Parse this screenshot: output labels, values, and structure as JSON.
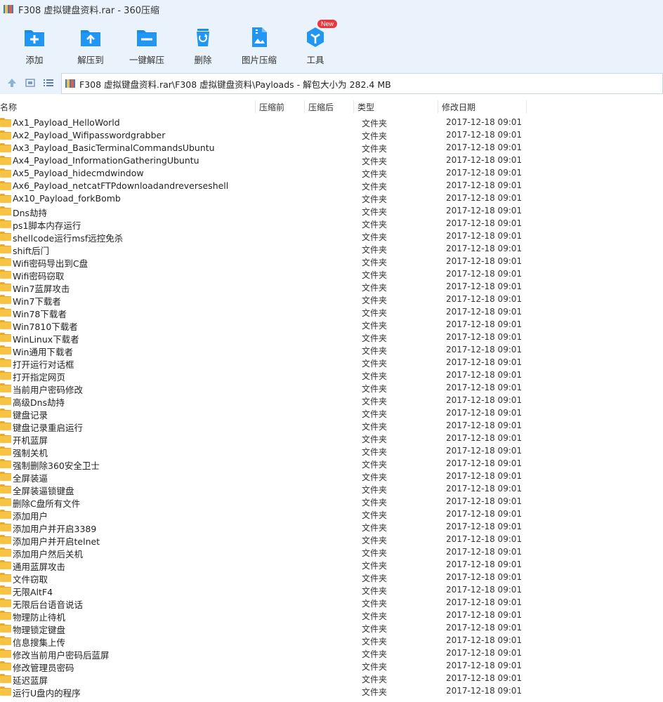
{
  "window": {
    "title": "F308  虚拟键盘资料.rar - 360压缩"
  },
  "toolbar": {
    "items": [
      {
        "label": "添加",
        "icon": "add-icon"
      },
      {
        "label": "解压到",
        "icon": "extract-to-icon"
      },
      {
        "label": "一键解压",
        "icon": "one-click-extract-icon"
      },
      {
        "label": "删除",
        "icon": "delete-icon"
      },
      {
        "label": "图片压缩",
        "icon": "image-compress-icon"
      },
      {
        "label": "工具",
        "icon": "tools-icon",
        "badge": "New"
      }
    ]
  },
  "addressbar": {
    "path": "F308  虚拟键盘资料.rar\\F308  虚拟键盘资料\\Payloads - 解包大小为 282.4 MB"
  },
  "columns": {
    "name": "名称",
    "compressed_before": "压缩前",
    "compressed_after": "压缩后",
    "type": "类型",
    "modified": "修改日期"
  },
  "files": [
    {
      "name": "Ax1_Payload_HelloWorld",
      "type": "文件夹",
      "date": "2017-12-18 09:01"
    },
    {
      "name": "Ax2_Payload_Wifipasswordgrabber",
      "type": "文件夹",
      "date": "2017-12-18 09:01"
    },
    {
      "name": "Ax3_Payload_BasicTerminalCommandsUbuntu",
      "type": "文件夹",
      "date": "2017-12-18 09:01"
    },
    {
      "name": "Ax4_Payload_InformationGatheringUbuntu",
      "type": "文件夹",
      "date": "2017-12-18 09:01"
    },
    {
      "name": "Ax5_Payload_hidecmdwindow",
      "type": "文件夹",
      "date": "2017-12-18 09:01"
    },
    {
      "name": "Ax6_Payload_netcatFTPdownloadandreverseshell",
      "type": "文件夹",
      "date": "2017-12-18 09:01"
    },
    {
      "name": "Ax10_Payload_forkBomb",
      "type": "文件夹",
      "date": "2017-12-18 09:01"
    },
    {
      "name": "Dns劫持",
      "type": "文件夹",
      "date": "2017-12-18 09:01"
    },
    {
      "name": "ps1脚本内存运行",
      "type": "文件夹",
      "date": "2017-12-18 09:01"
    },
    {
      "name": "shellcode运行msf远控免杀",
      "type": "文件夹",
      "date": "2017-12-18 09:01"
    },
    {
      "name": "shift后门",
      "type": "文件夹",
      "date": "2017-12-18 09:01"
    },
    {
      "name": "Wifi密码导出到C盘",
      "type": "文件夹",
      "date": "2017-12-18 09:01"
    },
    {
      "name": "Wifi密码窃取",
      "type": "文件夹",
      "date": "2017-12-18 09:01"
    },
    {
      "name": "Win7蓝屏攻击",
      "type": "文件夹",
      "date": "2017-12-18 09:01"
    },
    {
      "name": "Win7下载者",
      "type": "文件夹",
      "date": "2017-12-18 09:01"
    },
    {
      "name": "Win78下载者",
      "type": "文件夹",
      "date": "2017-12-18 09:01"
    },
    {
      "name": "Win7810下载者",
      "type": "文件夹",
      "date": "2017-12-18 09:01"
    },
    {
      "name": "WinLinux下载者",
      "type": "文件夹",
      "date": "2017-12-18 09:01"
    },
    {
      "name": "Win通用下载者",
      "type": "文件夹",
      "date": "2017-12-18 09:01"
    },
    {
      "name": "打开运行对话框",
      "type": "文件夹",
      "date": "2017-12-18 09:01"
    },
    {
      "name": "打开指定网页",
      "type": "文件夹",
      "date": "2017-12-18 09:01"
    },
    {
      "name": "当前用户密码修改",
      "type": "文件夹",
      "date": "2017-12-18 09:01"
    },
    {
      "name": "高级Dns劫持",
      "type": "文件夹",
      "date": "2017-12-18 09:01"
    },
    {
      "name": "键盘记录",
      "type": "文件夹",
      "date": "2017-12-18 09:01"
    },
    {
      "name": "键盘记录重启运行",
      "type": "文件夹",
      "date": "2017-12-18 09:01"
    },
    {
      "name": "开机蓝屏",
      "type": "文件夹",
      "date": "2017-12-18 09:01"
    },
    {
      "name": "强制关机",
      "type": "文件夹",
      "date": "2017-12-18 09:01"
    },
    {
      "name": "强制删除360安全卫士",
      "type": "文件夹",
      "date": "2017-12-18 09:01"
    },
    {
      "name": "全屏装逼",
      "type": "文件夹",
      "date": "2017-12-18 09:01"
    },
    {
      "name": "全屏装逼锁键盘",
      "type": "文件夹",
      "date": "2017-12-18 09:01"
    },
    {
      "name": "删除C盘所有文件",
      "type": "文件夹",
      "date": "2017-12-18 09:01"
    },
    {
      "name": "添加用户",
      "type": "文件夹",
      "date": "2017-12-18 09:01"
    },
    {
      "name": "添加用户并开启3389",
      "type": "文件夹",
      "date": "2017-12-18 09:01"
    },
    {
      "name": "添加用户并开启telnet",
      "type": "文件夹",
      "date": "2017-12-18 09:01"
    },
    {
      "name": "添加用户然后关机",
      "type": "文件夹",
      "date": "2017-12-18 09:01"
    },
    {
      "name": "通用蓝屏攻击",
      "type": "文件夹",
      "date": "2017-12-18 09:01"
    },
    {
      "name": "文件窃取",
      "type": "文件夹",
      "date": "2017-12-18 09:01"
    },
    {
      "name": "无限AltF4",
      "type": "文件夹",
      "date": "2017-12-18 09:01"
    },
    {
      "name": "无限后台语音说话",
      "type": "文件夹",
      "date": "2017-12-18 09:01"
    },
    {
      "name": "物理防止待机",
      "type": "文件夹",
      "date": "2017-12-18 09:01"
    },
    {
      "name": "物理锁定键盘",
      "type": "文件夹",
      "date": "2017-12-18 09:01"
    },
    {
      "name": "信息搜集上传",
      "type": "文件夹",
      "date": "2017-12-18 09:01"
    },
    {
      "name": "修改当前用户密码后蓝屏",
      "type": "文件夹",
      "date": "2017-12-18 09:01"
    },
    {
      "name": "修改管理员密码",
      "type": "文件夹",
      "date": "2017-12-18 09:01"
    },
    {
      "name": "延迟蓝屏",
      "type": "文件夹",
      "date": "2017-12-18 09:01"
    },
    {
      "name": "运行U盘内的程序",
      "type": "文件夹",
      "date": "2017-12-18 09:01"
    }
  ]
}
